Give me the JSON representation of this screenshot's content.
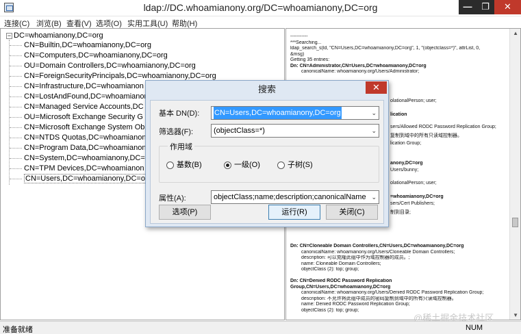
{
  "window": {
    "title": "ldap://DC.whoamianony.org/DC=whoamianony,DC=org",
    "minimize": "—",
    "maximize": "❐",
    "close": "✕"
  },
  "menu": [
    "连接(C)",
    "浏览(B)",
    "查看(V)",
    "选项(O)",
    "实用工具(U)",
    "帮助(H)"
  ],
  "tree": {
    "root": "DC=whoamianony,DC=org",
    "expander": "−",
    "items": [
      "CN=Builtin,DC=whoamianony,DC=org",
      "CN=Computers,DC=whoamianony,DC=org",
      "OU=Domain Controllers,DC=whoamianony,DC=org",
      "CN=ForeignSecurityPrincipals,DC=whoamianony,DC=org",
      "CN=Infrastructure,DC=whoamianon",
      "CN=LostAndFound,DC=whoamianon",
      "CN=Managed Service Accounts,DC",
      "OU=Microsoft Exchange Security G",
      "CN=Microsoft Exchange System Ob",
      "CN=NTDS Quotas,DC=whoamianon",
      "CN=Program Data,DC=whoamianon",
      "CN=System,DC=whoamianony,DC=",
      "CN=TPM Devices,DC=whoamianon",
      "CN=Users,DC=whoamianony,DC=o"
    ]
  },
  "log": [
    {
      "t": "-----------",
      "c": ""
    },
    {
      "t": "***Searching...",
      "c": ""
    },
    {
      "t": "ldap_search_s(ld, \"CN=Users,DC=whoamianony,DC=org\", 1, \"(objectclass=*)\", attrList,  0,",
      "c": ""
    },
    {
      "t": "&msg)",
      "c": ""
    },
    {
      "t": "Getting 35 entries:",
      "c": ""
    },
    {
      "t": "Dn: CN=Administrator,CN=Users,DC=whoamianony,DC=org",
      "c": "dn"
    },
    {
      "t": "canonicalName: whoamianony.org/Users/Administrator;",
      "c": "ind"
    },
    {
      "t": "",
      "c": ""
    },
    {
      "t": "",
      "c": ""
    },
    {
      "t": "",
      "c": ""
    },
    {
      "t": "",
      "c": ""
    },
    {
      "t": "",
      "c": ""
    },
    {
      "t": "",
      "c": ""
    },
    {
      "t": "",
      "c": ""
    },
    {
      "t": "",
      "c": ""
    },
    {
      "t": "",
      "c": ""
    },
    {
      "t": "",
      "c": ""
    },
    {
      "t": "",
      "c": ""
    },
    {
      "t": "",
      "c": ""
    },
    {
      "t": "",
      "c": ""
    },
    {
      "t": "",
      "c": ""
    },
    {
      "t": "",
      "c": ""
    },
    {
      "t": "",
      "c": ""
    },
    {
      "t": "",
      "c": ""
    },
    {
      "t": "",
      "c": ""
    },
    {
      "t": "",
      "c": ""
    },
    {
      "t": "",
      "c": ""
    },
    {
      "t": "",
      "c": ""
    },
    {
      "t": "",
      "c": ""
    },
    {
      "t": "",
      "c": ""
    },
    {
      "t": "",
      "c": ""
    },
    {
      "t": "",
      "c": ""
    },
    {
      "t": "",
      "c": ""
    },
    {
      "t": "",
      "c": ""
    },
    {
      "t": "",
      "c": ""
    },
    {
      "t": "",
      "c": ""
    },
    {
      "t": "Dn: CN=Cloneable Domain Controllers,CN=Users,DC=whoamianony,DC=org",
      "c": "dn"
    },
    {
      "t": "canonicalName: whoamianony.org/Users/Cloneable Domain Controllers;",
      "c": "ind"
    },
    {
      "t": "description: 可以克隆此组中作为域控制器的成员。;",
      "c": "ind"
    },
    {
      "t": "name: Cloneable Domain Controllers;",
      "c": "ind"
    },
    {
      "t": "objectClass (2): top; group;",
      "c": "ind"
    },
    {
      "t": "",
      "c": ""
    },
    {
      "t": "Dn: CN=Denied RODC Password Replication",
      "c": "dn"
    },
    {
      "t": "Group,CN=Users,DC=whoamianony,DC=org",
      "c": "dn"
    },
    {
      "t": "canonicalName: whoamianony.org/Users/Denied RODC Password Replication Group;",
      "c": "ind"
    },
    {
      "t": "description: 不允许将此组中成员的密码复制到域中的所有只读域控制器。",
      "c": "ind"
    },
    {
      "t": "name: Denied RODC Password Replication Group;",
      "c": "ind"
    },
    {
      "t": "objectClass (2): top; group;",
      "c": "ind"
    }
  ],
  "log_fragments": [
    "olationalPerson; user;",
    "lication",
    "sers/Allowed RODC Password Replication Group;",
    "复制到域中的所有只读域控制器。",
    "lication Group;",
    "anony,DC=org",
    "Users/bunny;",
    "olationalPerson; user;",
    "=whoamianony,DC=org",
    "sers/Cert Publishers;",
    "制到目录;"
  ],
  "scrollbar": {
    "up": "▲",
    "down": "▼"
  },
  "status": {
    "left": "准备就绪",
    "num": "NUM"
  },
  "watermark": "@稀土掘金技术社区",
  "dialog": {
    "title": "搜索",
    "close": "✕",
    "base_dn_label": "基本 DN(D):",
    "base_dn_value": "CN=Users,DC=whoamianony,DC=org",
    "filter_label": "筛选器(F):",
    "filter_value": "(objectClass=*)",
    "scope_label": "作用域",
    "scope_options": [
      "基数(B)",
      "一级(O)",
      "子树(S)"
    ],
    "scope_selected": 1,
    "attributes_label": "属性(A):",
    "attributes_value": "objectClass;name;description;canonicalName",
    "options_button": "选项(P)",
    "run_button": "运行(R)",
    "close_button": "关闭(C)",
    "dropdown_arrow": "⌄"
  }
}
